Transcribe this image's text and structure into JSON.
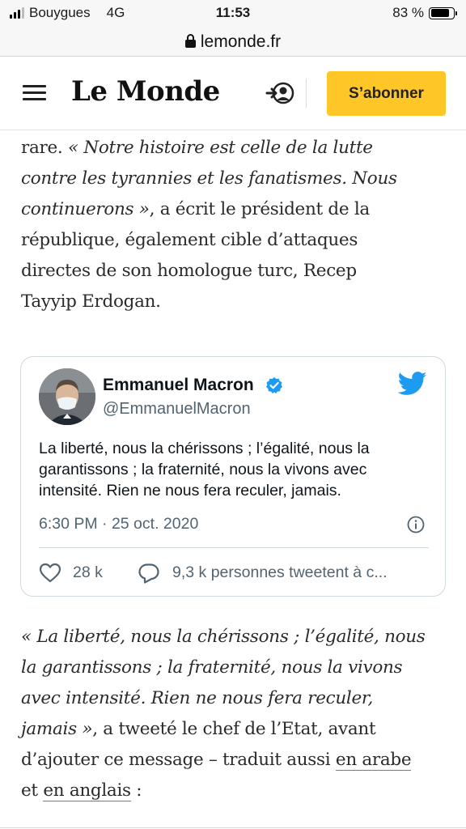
{
  "status_bar": {
    "carrier": "Bouygues",
    "network": "4G",
    "time": "11:53",
    "battery": "83 %",
    "battery_level": 0.83
  },
  "url_bar": {
    "domain": "lemonde.fr"
  },
  "header": {
    "logo": "Le Monde",
    "subscribe_label": "S’abonner",
    "accent_color": "#ffc627"
  },
  "article": {
    "paragraph1": [
      {
        "normal": "rare. ",
        "italic": "« Notre histoire est celle de la lutte"
      },
      {
        "italic": "contre les tyrannies et les fanatismes. Nous"
      },
      {
        "italic": "continuerons »",
        "normal": ", a écrit le président de la"
      },
      {
        "normal": "république, également cible d’attaques"
      },
      {
        "normal": "directes de son homologue turc, Recep"
      },
      {
        "normal": "Tayyip Erdogan."
      }
    ],
    "paragraph2": {
      "lines_italic": [
        "« La liberté, nous la chérissons ; l’égalité, nous",
        "la garantissons ; la fraternité, nous la vivons",
        "avec intensité. Rien ne nous fera reculer,"
      ],
      "line4_italic": "jamais »",
      "line4_normal": ", a tweeté le chef de l’Etat, avant",
      "line5_normal": "d’ajouter ce message – traduit aussi ",
      "link_arabic": "en arabe",
      "line6_prefix": "et ",
      "link_english": "en anglais",
      "line6_suffix": " :"
    }
  },
  "tweet": {
    "author_name": "Emmanuel Macron",
    "handle": "@EmmanuelMacron",
    "text_lines": [
      "La liberté, nous la chérissons ; l’égalité, nous la",
      "garantissons ; la fraternité, nous la vivons avec",
      "intensité. Rien ne nous fera reculer, jamais."
    ],
    "timestamp": "6:30 PM · 25 oct. 2020",
    "likes": "28 k",
    "replies": "9,3 k personnes tweetent à c...",
    "brand_color": "#1d9bf0"
  }
}
